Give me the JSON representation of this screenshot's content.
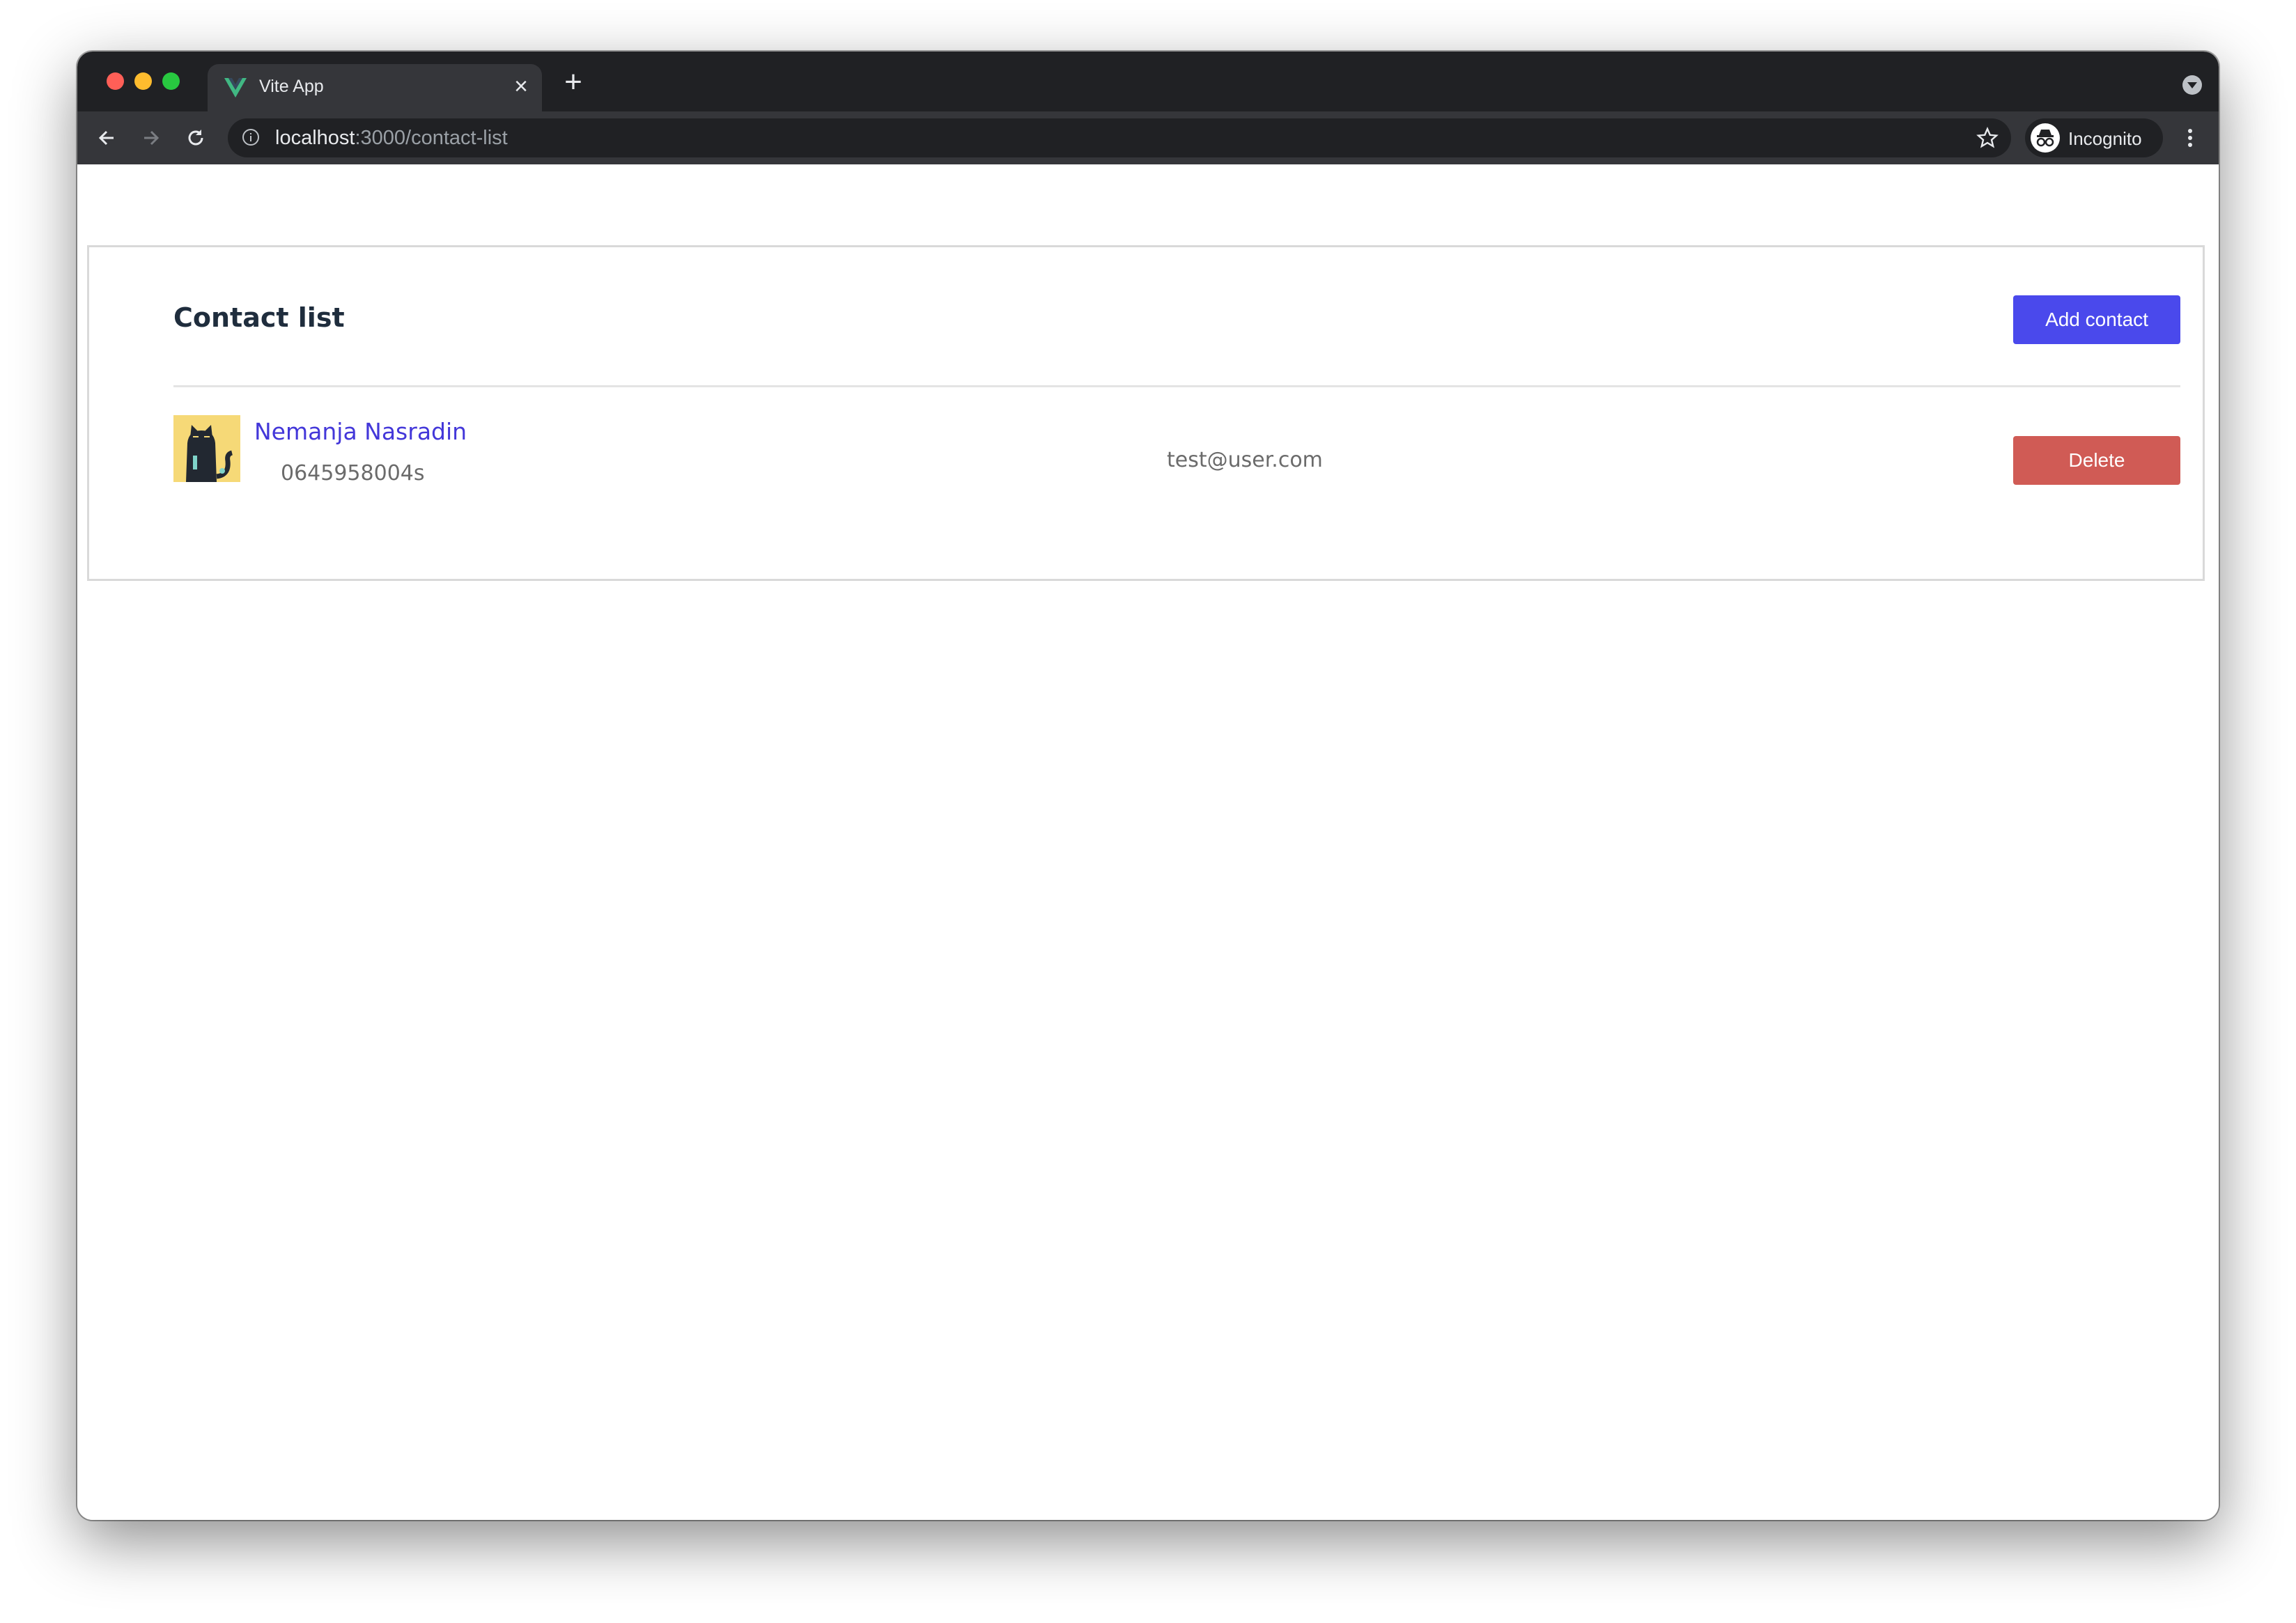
{
  "browser": {
    "tab_title": "Vite App",
    "tab_close_icon": "close-icon",
    "new_tab_icon": "plus-icon",
    "url_host": "localhost",
    "url_path": ":3000/contact-list",
    "profile_label": "Incognito"
  },
  "page": {
    "title": "Contact list",
    "add_button_label": "Add contact",
    "contacts": [
      {
        "name": "Nemanja Nasradin",
        "phone": "0645958004s",
        "email": "test@user.com",
        "delete_label": "Delete",
        "avatar_icon": "black-cat-avatar"
      }
    ]
  },
  "colors": {
    "primary": "#4a49ec",
    "danger": "#d05b55",
    "link": "#4337d9",
    "avatar_bg": "#f6d977"
  }
}
